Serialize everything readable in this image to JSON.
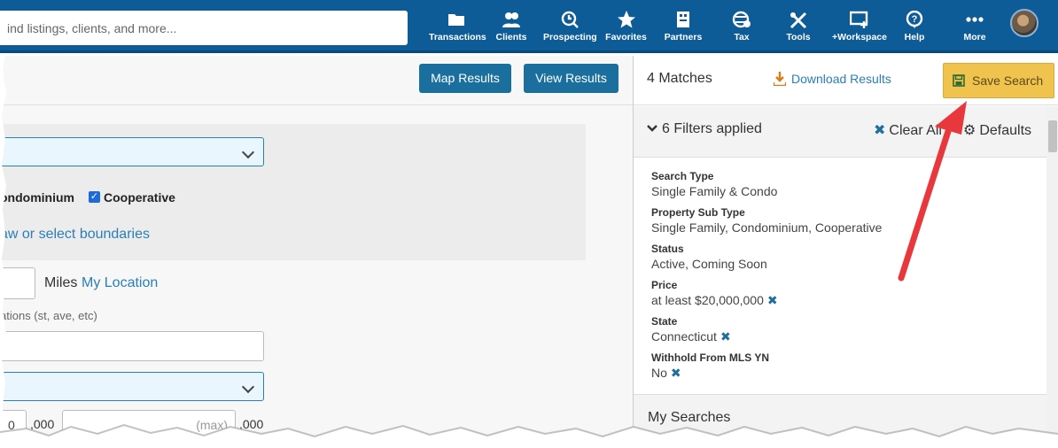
{
  "topbar": {
    "search_placeholder": "ind listings, clients, and more...",
    "nav": [
      {
        "label": "Transactions",
        "icon": "folder-icon"
      },
      {
        "label": "Clients",
        "icon": "users-icon"
      },
      {
        "label": "Prospecting",
        "icon": "clock-search-icon"
      },
      {
        "label": "Favorites",
        "icon": "star-icon"
      },
      {
        "label": "Partners",
        "icon": "partners-icon"
      },
      {
        "label": "Tax",
        "icon": "tax-globe-icon"
      },
      {
        "label": "Tools",
        "icon": "tools-icon"
      },
      {
        "label": "+Workspace",
        "icon": "workspace-icon"
      },
      {
        "label": "Help",
        "icon": "help-icon"
      },
      {
        "label": "More",
        "icon": "more-dots-icon"
      }
    ],
    "colors": {
      "bar": "#0d5b97"
    }
  },
  "left": {
    "map_results": "Map Results",
    "view_results": "View Results",
    "property_types": {
      "condominium": "ondominium",
      "cooperative": "Cooperative"
    },
    "draw_link": "aw or select boundaries",
    "miles": "Miles",
    "my_location": "My Location",
    "street_hint": "ations (st, ave, etc)",
    "price_min_suffix": ",000",
    "price_max_placeholder": "(max)",
    "price_max_suffix": ",000",
    "price_min_value": "0"
  },
  "right": {
    "matches": "4 Matches",
    "download": "Download Results",
    "save_search": "Save Search",
    "filters_applied": "6 Filters applied",
    "clear_all": "Clear All",
    "defaults": "Defaults",
    "filters": [
      {
        "label": "Search Type",
        "value": "Single Family & Condo",
        "removable": false
      },
      {
        "label": "Property Sub Type",
        "value": "Single Family, Condominium, Cooperative",
        "removable": false
      },
      {
        "label": "Status",
        "value": "Active, Coming Soon",
        "removable": false
      },
      {
        "label": "Price",
        "value": "at least $20,000,000",
        "removable": true
      },
      {
        "label": "State",
        "value": "Connecticut",
        "removable": true
      },
      {
        "label": "Withhold From MLS YN",
        "value": "No",
        "removable": true
      }
    ],
    "my_searches": "My Searches",
    "colors": {
      "save_button": "#f0c24e",
      "accent": "#2a7fb6",
      "annotation_arrow": "#e8383d"
    }
  }
}
